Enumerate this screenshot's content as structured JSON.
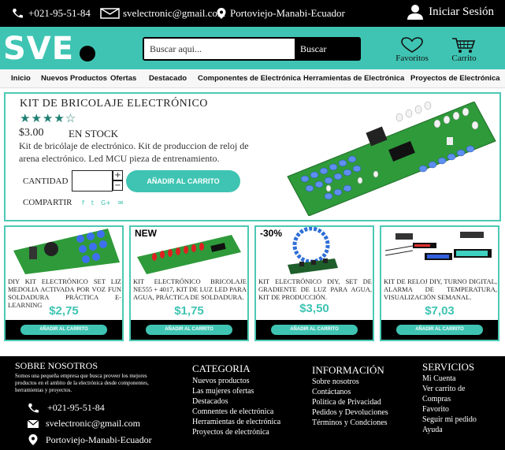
{
  "topbar": {
    "phone": "+021-95-51-84",
    "email": "svelectronic@gmail.com",
    "location": "Portoviejo-Manabi-Ecuador",
    "login": "Iniciar Sesión"
  },
  "header": {
    "logo": "SVE",
    "search_placeholder": "Buscar aqui...",
    "search_button": "Buscar",
    "favorites": "Favoritos",
    "cart": "Carrito"
  },
  "nav": [
    "Inicio",
    "Nuevos Productos",
    "Ofertas",
    "Destacado",
    "Componentes de Electrónica",
    "Herramientas de Electrónica",
    "Proyectos de Electrónica"
  ],
  "product": {
    "title": "KIT  DE BRICOLAJE  ELECTRÓNICO",
    "rating_stars": "★★★★☆",
    "rating": 4,
    "price": "$3.00",
    "stock": "EN STOCK",
    "description": "Kit de bricólaje de electrónico. Kit de produccion de reloj de arena electrónico. Led MCU pieza de entrenamiento.",
    "quantity_label": "CANTIDAD",
    "quantity_value": "",
    "plus": "+",
    "minus": "−",
    "add_to_cart": "AÑADIR AL CARRITO",
    "share_label": "COMPARTIR",
    "share_icons": [
      "facebook-icon",
      "twitter-icon",
      "google-plus-icon",
      "mail-icon"
    ]
  },
  "cards": [
    {
      "badge": "",
      "text": "DIY KIT ELECTRÓNICO SET LIZ MEDOLIA ACTIVADA POR VOZ FUN SOLDADURA PRÁCTICA E-LEARNING",
      "price": "$2,75",
      "button": "AÑADIR AL CARRITO"
    },
    {
      "badge": "NEW",
      "text": "KIT ELECTRÓNICO BRICOLAJE NE555 + 4017, KIT DE LUZ LED PARA AGUA, PRÁCTICA DE SOLDADURA.",
      "price": "$1,75",
      "button": "AÑADIR AL CARRITO"
    },
    {
      "badge": "-30%",
      "text": "KIT ELECTRÓNICO DIY, SET DE GRADIENTE DE LUZ PARA AGUA, KIT DE PRODUCCIÓN.",
      "price": "$3,50",
      "button": "AÑADIR AL CARRITO"
    },
    {
      "badge": "",
      "text": "KIT DE RELOJ DIY, TURNO DIGITAL, ALARMA DE TEMPERATURA, VISUALIZACIÓN SEMANAL.",
      "price": "$7,03",
      "button": "AÑADIR AL CARRITO"
    }
  ],
  "footer": {
    "about_title": "SOBRE NOSOTROS",
    "about_text": "Somos una pequeña empresa que busca proveer los mejores productos en el ambito de la electrónica desde componentes, herramientas y proyectos.",
    "phone": "+021-95-51-84",
    "email": "svelectronic@gmail.com",
    "location": "Portoviejo-Manabi-Ecuador",
    "categoria_title": "CATEGORIA",
    "categoria": [
      "Nuevos productos",
      "Las mujeres ofertas",
      "Destacados",
      "Comnentes de electrónica",
      "Herramientas de electrónica",
      "Proyectos de electrónica"
    ],
    "info_title": "INFORMACIÓN",
    "info": [
      "Sobre nosotros",
      "Contáctanos",
      "Politica de Privacidad",
      "Pedidos y Devoluciones",
      "Términos y Condciones"
    ],
    "services_title": "SERVICIOS",
    "services": [
      "Mi Cuenta",
      "Ver carrito de",
      "Compras",
      "Favorito",
      "Seguir mi pedido",
      "Ayuda"
    ]
  },
  "colors": {
    "accent": "#3fc4b3",
    "dark": "#000000",
    "pcb_green": "#2e9a3a"
  }
}
